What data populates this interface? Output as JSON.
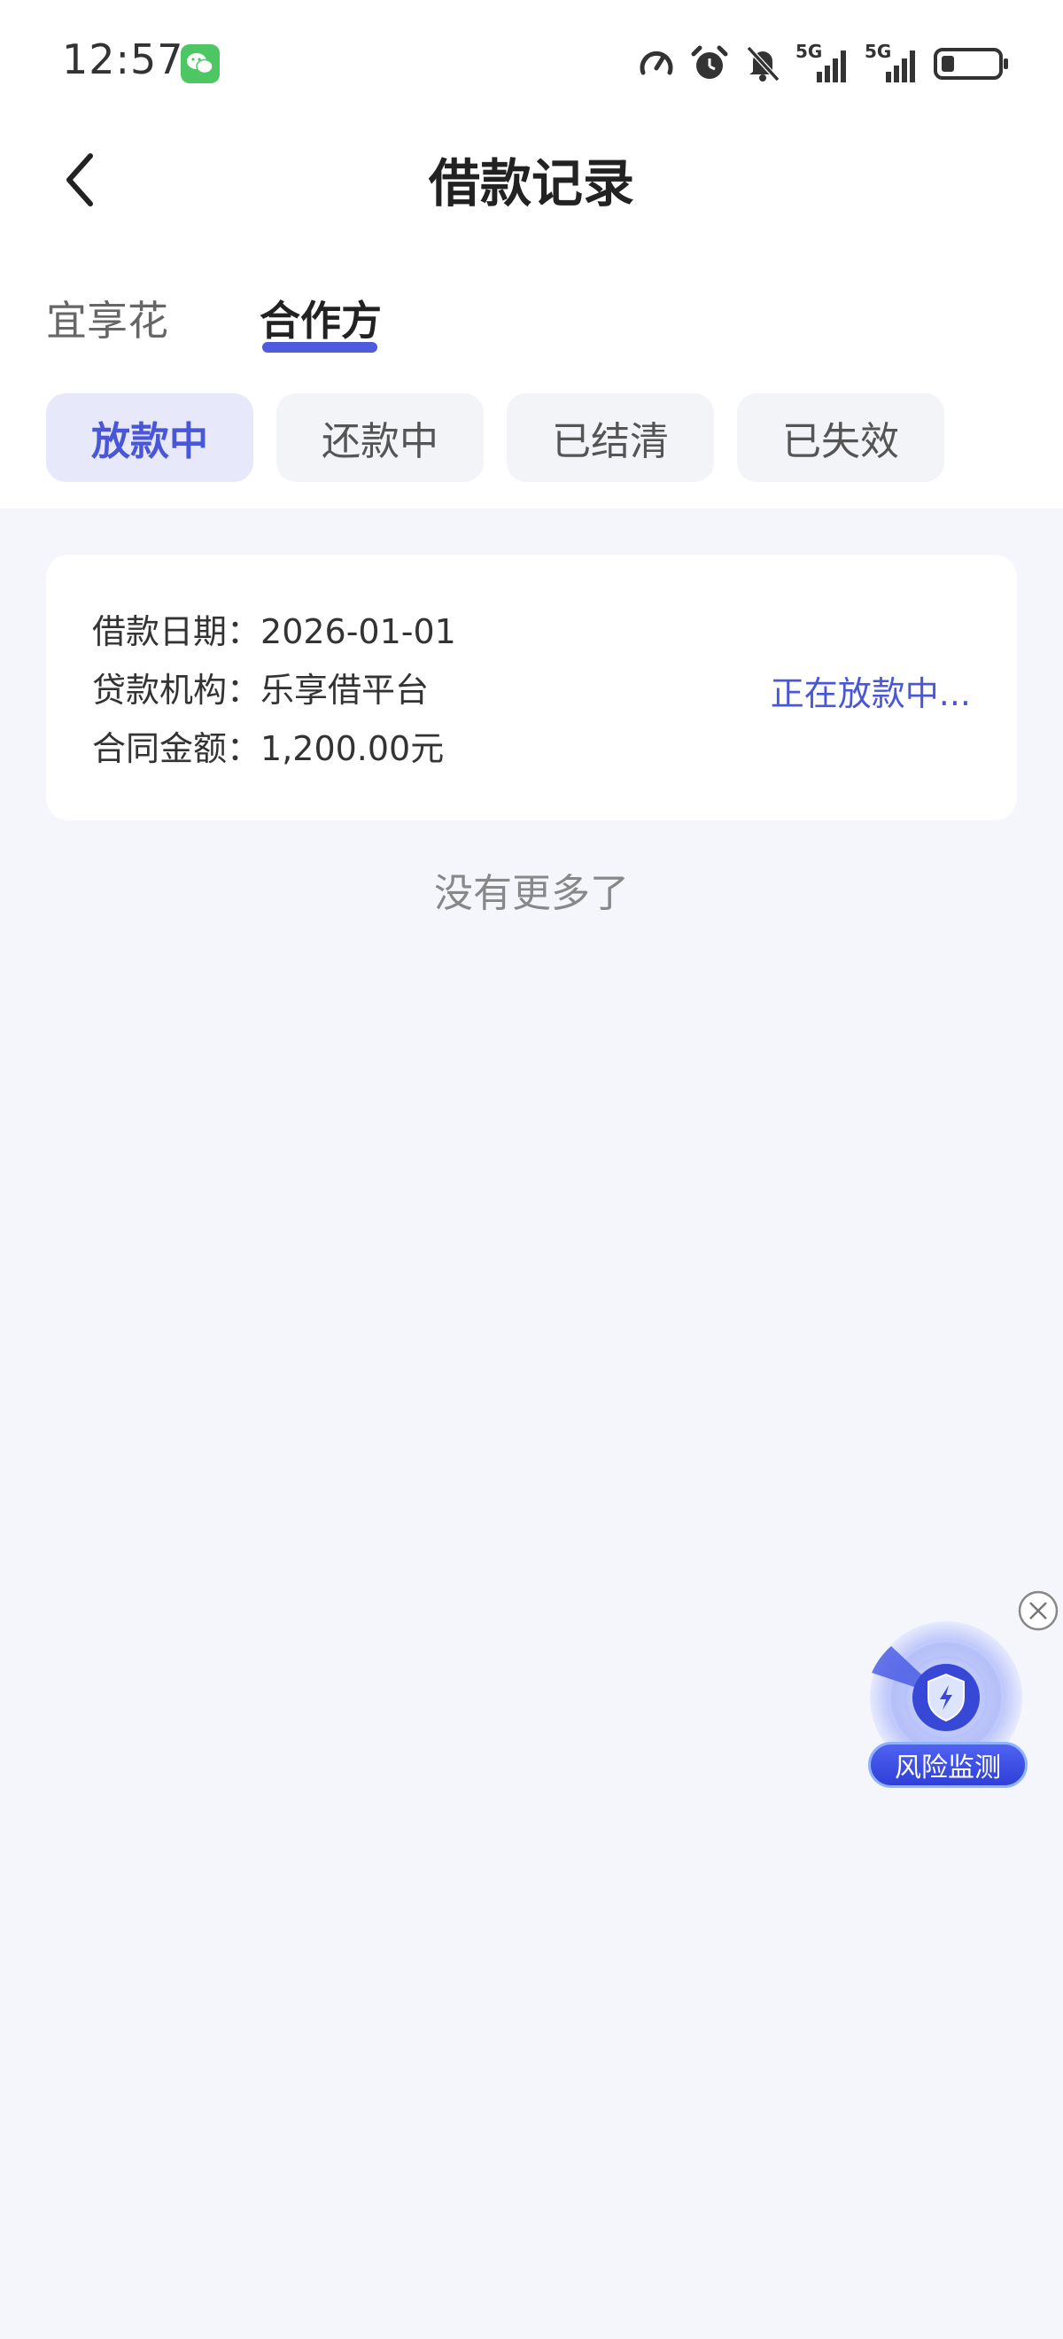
{
  "status_bar": {
    "time": "12:57",
    "icons": [
      "wechat-icon",
      "speed-icon",
      "alarm-icon",
      "bell-off-icon",
      "signal-5g-icon",
      "signal-5g-icon",
      "battery-icon"
    ],
    "network_label_1": "5G",
    "network_label_2": "5G",
    "accent_wechat": "#4cc764"
  },
  "header": {
    "title": "借款记录",
    "back_icon": "chevron-left-icon"
  },
  "main_tabs": [
    {
      "label": "宜享花",
      "active": false
    },
    {
      "label": "合作方",
      "active": true
    }
  ],
  "status_filters": [
    {
      "label": "放款中",
      "active": true
    },
    {
      "label": "还款中",
      "active": false
    },
    {
      "label": "已结清",
      "active": false
    },
    {
      "label": "已失效",
      "active": false
    }
  ],
  "records": [
    {
      "date_label": "借款日期：",
      "date_value": "2026-01-01",
      "lender_label": "贷款机构：",
      "lender_value": "乐享借平台",
      "amount_label": "合同金额：",
      "amount_value": "1,200.00元",
      "status": "正在放款中..."
    }
  ],
  "list_end_text": "没有更多了",
  "floating_widget": {
    "label": "风险监测",
    "icon": "shield-lightning-icon",
    "close_icon": "close-circle-icon"
  },
  "colors": {
    "accent": "#4a56d8",
    "background": "#f5f6fb"
  }
}
